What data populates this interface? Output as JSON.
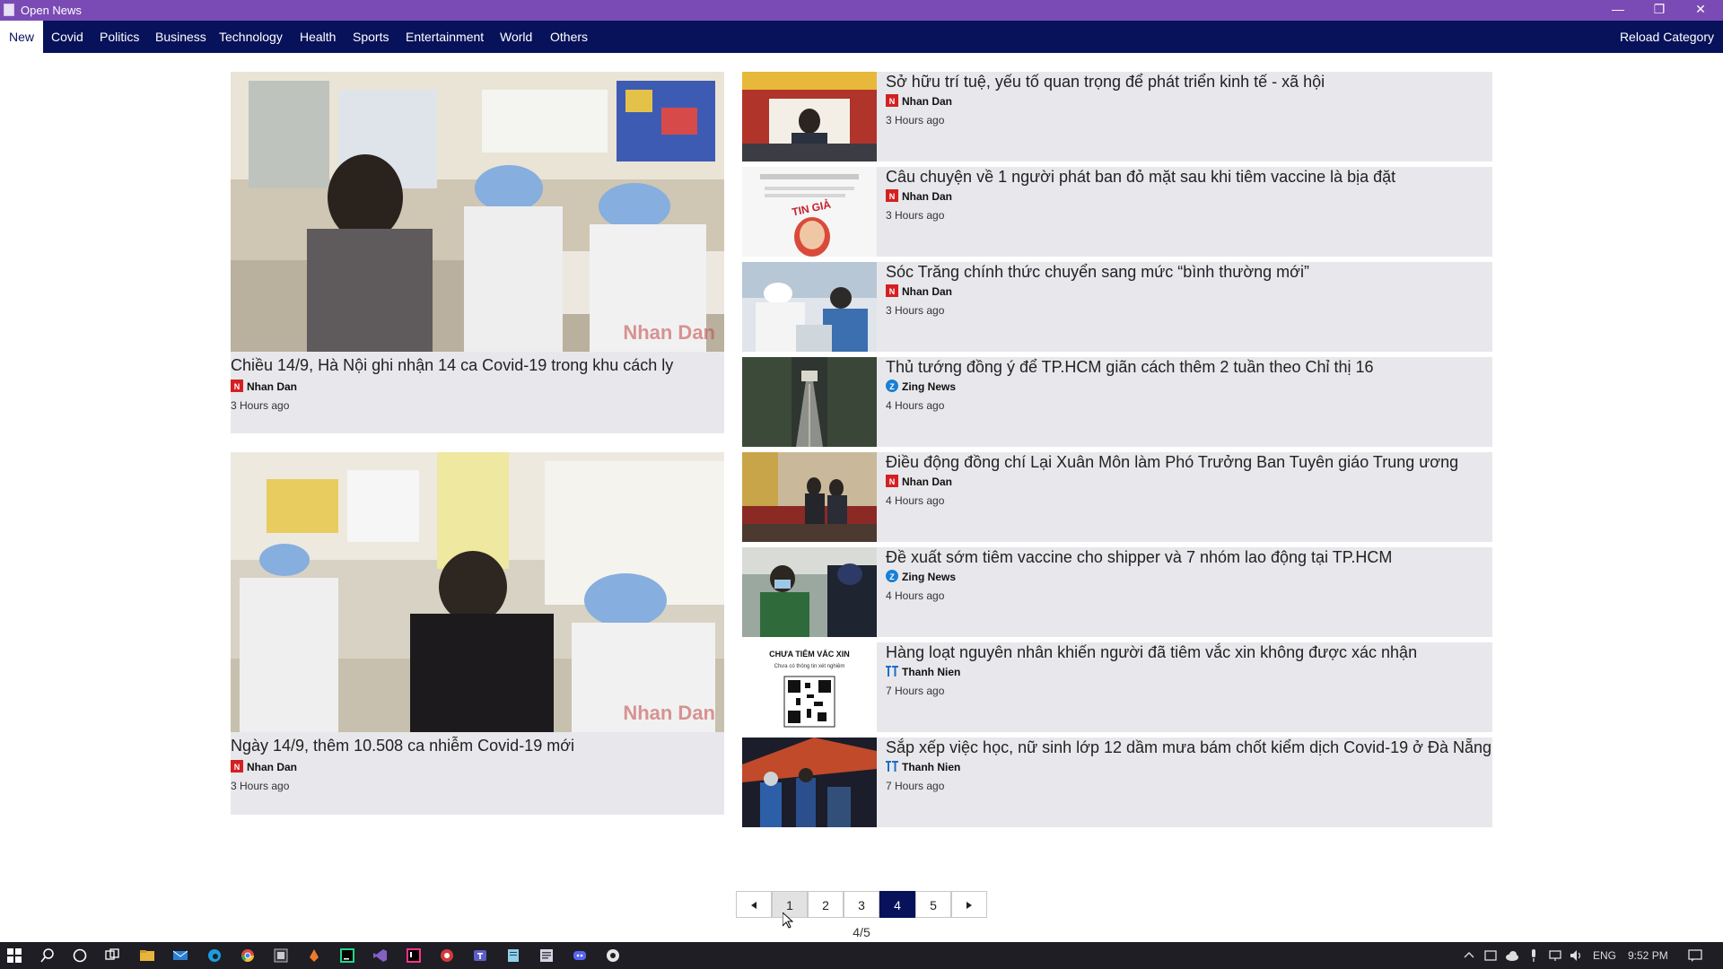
{
  "window": {
    "title": "Open News"
  },
  "nav": {
    "tabs": [
      "New",
      "Covid",
      "Politics",
      "Business",
      "Technology",
      "Health",
      "Sports",
      "Entertainment",
      "World",
      "Others"
    ],
    "active": "New",
    "reload_label": "Reload Category"
  },
  "featured": [
    {
      "title": "Chiều 14/9, Hà Nội ghi nhận 14 ca Covid-19 trong khu cách ly",
      "source": "Nhan Dan",
      "time": "3 Hours ago",
      "watermark": "Nhan Dan"
    },
    {
      "title": "Ngày 14/9, thêm 10.508 ca nhiễm Covid-19 mới",
      "source": "Nhan Dan",
      "time": "3 Hours ago",
      "watermark": "Nhan Dan"
    }
  ],
  "articles": [
    {
      "title": "Sở hữu trí tuệ, yếu tố quan trọng để phát triển kinh tế - xã hội",
      "source": "Nhan Dan",
      "time": "3 Hours ago",
      "logo": "nd"
    },
    {
      "title": "Câu chuyện về 1 người phát ban đỏ mặt sau khi tiêm vaccine là bịa đặt",
      "source": "Nhan Dan",
      "time": "3 Hours ago",
      "logo": "nd",
      "stamp": "TIN GIẢ"
    },
    {
      "title": "Sóc Trăng chính thức chuyển sang mức “bình thường mới”",
      "source": "Nhan Dan",
      "time": "3 Hours ago",
      "logo": "nd"
    },
    {
      "title": "Thủ tướng đồng ý để TP.HCM giãn cách thêm 2 tuần theo Chỉ thị 16",
      "source": "Zing News",
      "time": "4 Hours ago",
      "logo": "zing"
    },
    {
      "title": "Điều động đồng chí Lại Xuân Môn làm Phó Trưởng Ban Tuyên giáo Trung ương",
      "source": "Nhan Dan",
      "time": "4 Hours ago",
      "logo": "nd"
    },
    {
      "title": "Đề xuất sớm tiêm vaccine cho shipper và 7 nhóm lao động tại TP.HCM",
      "source": "Zing News",
      "time": "4 Hours ago",
      "logo": "zing"
    },
    {
      "title": "Hàng loạt nguyên nhân khiến người đã tiêm vắc xin không được xác nhận",
      "source": "Thanh Nien",
      "time": "7 Hours ago",
      "logo": "tn",
      "thumb_heading": "CHƯA TIÊM VẮC XIN",
      "thumb_sub": "Chưa có thông tin xét nghiệm"
    },
    {
      "title": "Sắp xếp việc học, nữ sinh lớp 12 dầm mưa bám chốt kiểm dịch Covid-19 ở Đà Nẵng",
      "source": "Thanh Nien",
      "time": "7 Hours ago",
      "logo": "tn"
    }
  ],
  "pagination": {
    "pages": [
      "1",
      "2",
      "3",
      "4",
      "5"
    ],
    "current": "4",
    "hover": "1",
    "prev_icon": "triangle-left",
    "next_icon": "triangle-right",
    "indicator": "4/5"
  },
  "taskbar": {
    "language": "ENG",
    "time": "9:52 PM"
  },
  "colors": {
    "accent": "#08125a",
    "titlebar": "#7b4bb5",
    "card": "#e8e8ec",
    "nhandan_red": "#d42020",
    "zing_blue": "#1a7fd4",
    "thanhnien_blue": "#1e6ec8"
  }
}
